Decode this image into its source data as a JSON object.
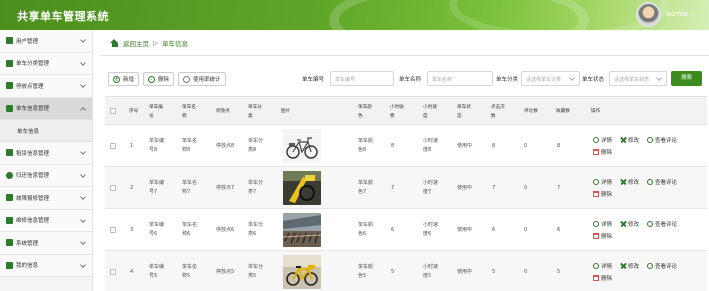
{
  "app": {
    "title": "共享单车管理系统",
    "user": "admin"
  },
  "sidebar": {
    "items": [
      {
        "label": "用户管理"
      },
      {
        "label": "单车分类管理"
      },
      {
        "label": "停放点管理"
      },
      {
        "label": "单车信息管理"
      },
      {
        "label": "租赁信息管理"
      },
      {
        "label": "归还信息管理"
      },
      {
        "label": "故障报修管理"
      },
      {
        "label": "维修信息管理"
      },
      {
        "label": "系统管理"
      },
      {
        "label": "我的信息"
      }
    ],
    "sub": "单车信息"
  },
  "breadcrumb": {
    "home": "返回主页",
    "sep": "▷",
    "current": "单车信息"
  },
  "toolbar": {
    "add": "新增",
    "delete": "删除",
    "stats": "使用率统计"
  },
  "filters": {
    "code_label": "单车编号",
    "code_placeholder": "单车编号",
    "name_label": "单车名称",
    "name_placeholder": "单车名称",
    "cat_label": "单车分类",
    "cat_placeholder": "请选择单车分类",
    "status_label": "单车状态",
    "status_placeholder": "请选择单车状态",
    "search": "搜索"
  },
  "table": {
    "headers": [
      "序号",
      "单车编号",
      "单车名称",
      "停放点",
      "单车分类",
      "图片",
      "单车颜色",
      "小时收费",
      "小时速度",
      "单车状态",
      "点击次数",
      "评论数",
      "收藏数",
      "操作"
    ],
    "rows": [
      {
        "idx": "1",
        "code": "单车编号8",
        "name": "单车名称8",
        "spot": "停放点8",
        "cat": "单车分类8",
        "color": "单车颜色8",
        "fee": "8",
        "speed": "小时速度8",
        "status": "使用中",
        "clicks": "8",
        "comments": "0",
        "favs": "8"
      },
      {
        "idx": "2",
        "code": "单车编号7",
        "name": "单车名称7",
        "spot": "停放点7",
        "cat": "单车分类7",
        "color": "单车颜色7",
        "fee": "7",
        "speed": "小时速度7",
        "status": "使用中",
        "clicks": "7",
        "comments": "0",
        "favs": "7"
      },
      {
        "idx": "3",
        "code": "单车编号6",
        "name": "单车名称6",
        "spot": "停放点6",
        "cat": "单车分类6",
        "color": "单车颜色6",
        "fee": "6",
        "speed": "小时速度6",
        "status": "使用中",
        "clicks": "6",
        "comments": "0",
        "favs": "6"
      },
      {
        "idx": "4",
        "code": "单车编号5",
        "name": "单车名称5",
        "spot": "停放点5",
        "cat": "单车分类5",
        "color": "单车颜色5",
        "fee": "5",
        "speed": "小时速度5",
        "status": "使用中",
        "clicks": "5",
        "comments": "0",
        "favs": "5"
      }
    ],
    "actions": {
      "detail": "详情",
      "edit": "修改",
      "review": "查看评论",
      "delete": "删除"
    }
  },
  "colors": {
    "brand": "#4c8f1e",
    "accent": "#3d8a1f",
    "danger": "#d9534f"
  }
}
